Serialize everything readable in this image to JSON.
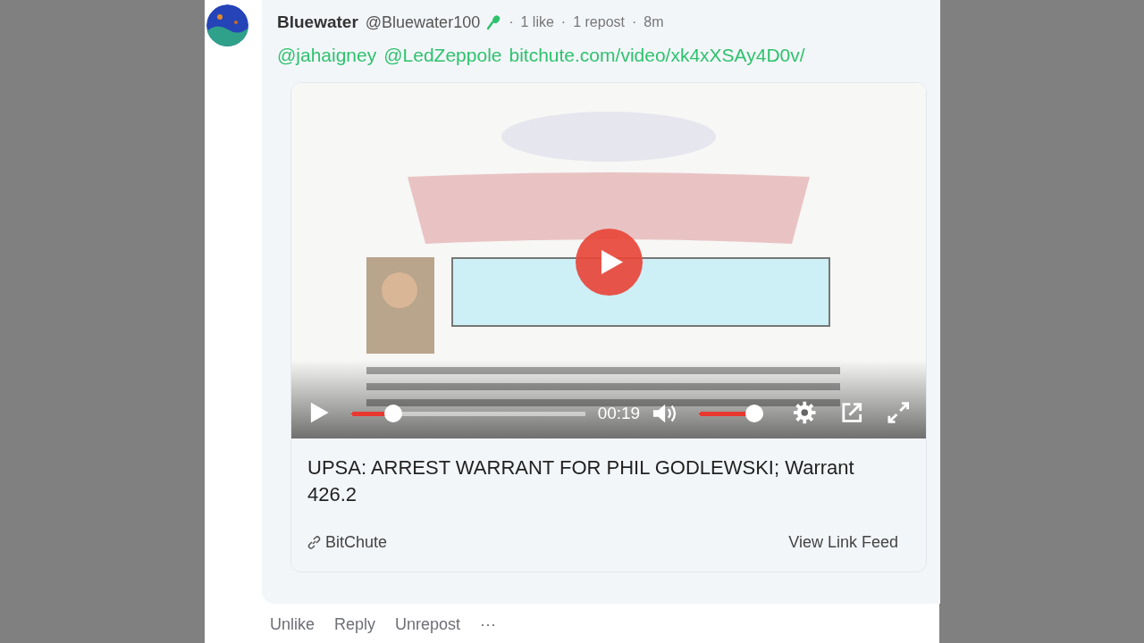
{
  "post": {
    "author": "Bluewater",
    "handle": "@Bluewater100",
    "meta_separator": "·",
    "meta": [
      "1 like",
      "1 repost",
      "8m"
    ],
    "body": [
      "@jahaigney",
      "@LedZeppole",
      "bitchute.com/video/xk4xXSAy4D0v/"
    ],
    "embed": {
      "video": {
        "kind": "picture",
        "time": "00:19",
        "progress": {
          "level": 0.18
        },
        "volume": {
          "level": 0.85
        }
      },
      "title": "UPSA: ARREST WARRANT FOR PHIL GODLEWSKI; Warrant 426.2",
      "source": "BitChute",
      "feed_link": "View Link Feed"
    },
    "actions": [
      "Unlike",
      "Reply",
      "Unrepost",
      "···"
    ]
  }
}
